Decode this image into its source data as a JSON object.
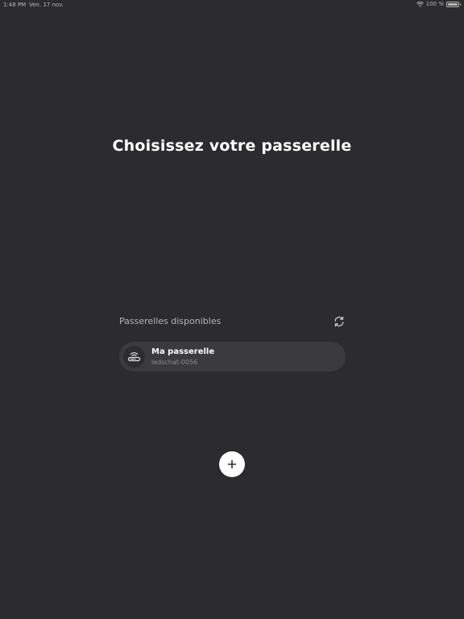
{
  "status_bar": {
    "time": "1:48 PM",
    "date": "Ven. 17 nov.",
    "battery": "100 %",
    "battery_level": 1.0
  },
  "page": {
    "title": "Choisissez votre passerelle"
  },
  "gateways": {
    "section_label": "Passerelles disponibles",
    "refresh_icon": "refresh-icon",
    "items": [
      {
        "name": "Ma passerelle",
        "id": "ledschat-0056",
        "icon": "router-icon"
      }
    ]
  },
  "actions": {
    "add_icon": "plus-icon"
  },
  "colors": {
    "background": "#2c2b2d",
    "card": "#3b3a3c",
    "text_primary": "#ffffff",
    "text_secondary": "#b5b5b5"
  }
}
